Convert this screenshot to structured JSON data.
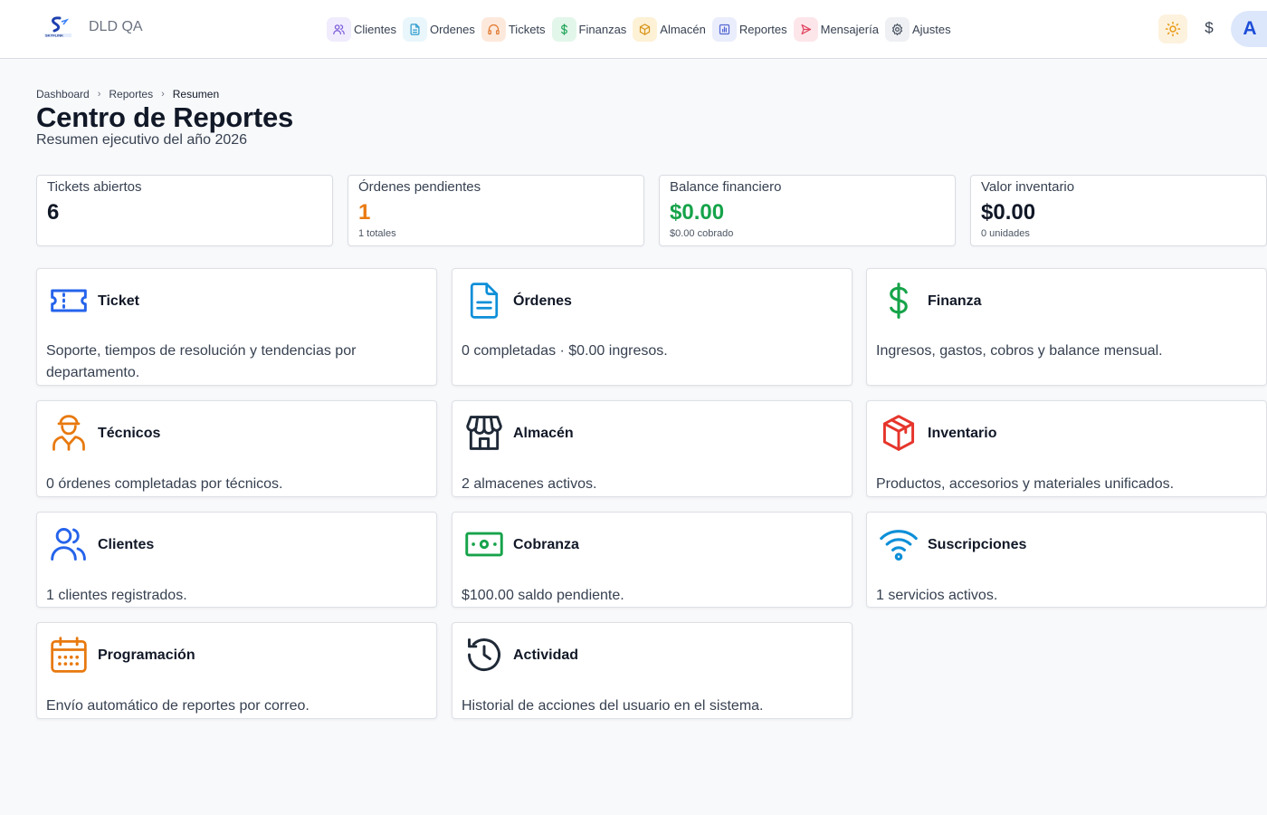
{
  "app": {
    "title": "DLD QA",
    "logo_text": "SKYFLINK"
  },
  "nav": [
    {
      "label": "Clientes",
      "icon": "users-icon",
      "bg": "#f0ecfd",
      "color": "#7c5cdb"
    },
    {
      "label": "Ordenes",
      "icon": "document-icon",
      "bg": "#e9f6fb",
      "color": "#2e9ccd"
    },
    {
      "label": "Tickets",
      "icon": "headset-icon",
      "bg": "#fde9dc",
      "color": "#e07a32"
    },
    {
      "label": "Finanzas",
      "icon": "dollar-icon",
      "bg": "#e3f6ea",
      "color": "#22a55a"
    },
    {
      "label": "Almacén",
      "icon": "cube-icon",
      "bg": "#fdf1d6",
      "color": "#d9961b"
    },
    {
      "label": "Reportes",
      "icon": "chart-icon",
      "bg": "#eaedfb",
      "color": "#5468d4"
    },
    {
      "label": "Mensajería",
      "icon": "send-icon",
      "bg": "#fde6ea",
      "color": "#e0445f"
    },
    {
      "label": "Ajustes",
      "icon": "gear-icon",
      "bg": "#eef0f3",
      "color": "#4b5563"
    }
  ],
  "toolbar": {
    "theme_icon": "sun-icon",
    "currency_symbol": "$",
    "avatar_initial": "A"
  },
  "breadcrumb": [
    "Dashboard",
    "Reportes",
    "Resumen"
  ],
  "page": {
    "title": "Centro de Reportes",
    "subtitle": "Resumen ejecutivo del año 2026"
  },
  "stats": [
    {
      "label": "Tickets abiertos",
      "value": "6",
      "sub": "",
      "color": "#111827"
    },
    {
      "label": "Órdenes pendientes",
      "value": "1",
      "sub": "1 totales",
      "color": "#ea7a12"
    },
    {
      "label": "Balance financiero",
      "value": "$0.00",
      "sub": "$0.00 cobrado",
      "color": "#16a34a"
    },
    {
      "label": "Valor inventario",
      "value": "$0.00",
      "sub": "0 unidades",
      "color": "#111827"
    }
  ],
  "cards": [
    {
      "title": "Ticket",
      "desc": "Soporte, tiempos de resolución y tendencias por departamento.",
      "icon": "ticket-icon",
      "color": "#2563eb"
    },
    {
      "title": "Órdenes",
      "desc": "0 completadas · $0.00 ingresos.",
      "icon": "document-icon",
      "color": "#0e8fd8"
    },
    {
      "title": "Finanza",
      "desc": "Ingresos, gastos, cobros y balance mensual.",
      "icon": "dollar-icon",
      "color": "#16a34a"
    },
    {
      "title": "Técnicos",
      "desc": "0 órdenes completadas por técnicos.",
      "icon": "technician-icon",
      "color": "#e8790e"
    },
    {
      "title": "Almacén",
      "desc": "2 almacenes activos.",
      "icon": "store-icon",
      "color": "#1f2937"
    },
    {
      "title": "Inventario",
      "desc": "Productos, accesorios y materiales unificados.",
      "icon": "cube-icon",
      "color": "#e6352b"
    },
    {
      "title": "Clientes",
      "desc": "1 clientes registrados.",
      "icon": "users-icon",
      "color": "#2563eb"
    },
    {
      "title": "Cobranza",
      "desc": "$100.00 saldo pendiente.",
      "icon": "cash-icon",
      "color": "#16a34a"
    },
    {
      "title": "Suscripciones",
      "desc": "1 servicios activos.",
      "icon": "wifi-icon",
      "color": "#0e8fd8"
    },
    {
      "title": "Programación",
      "desc": "Envío automático de reportes por correo.",
      "icon": "calendar-icon",
      "color": "#e8790e"
    },
    {
      "title": "Actividad",
      "desc": "Historial de acciones del usuario en el sistema.",
      "icon": "history-icon",
      "color": "#1f2937"
    }
  ]
}
